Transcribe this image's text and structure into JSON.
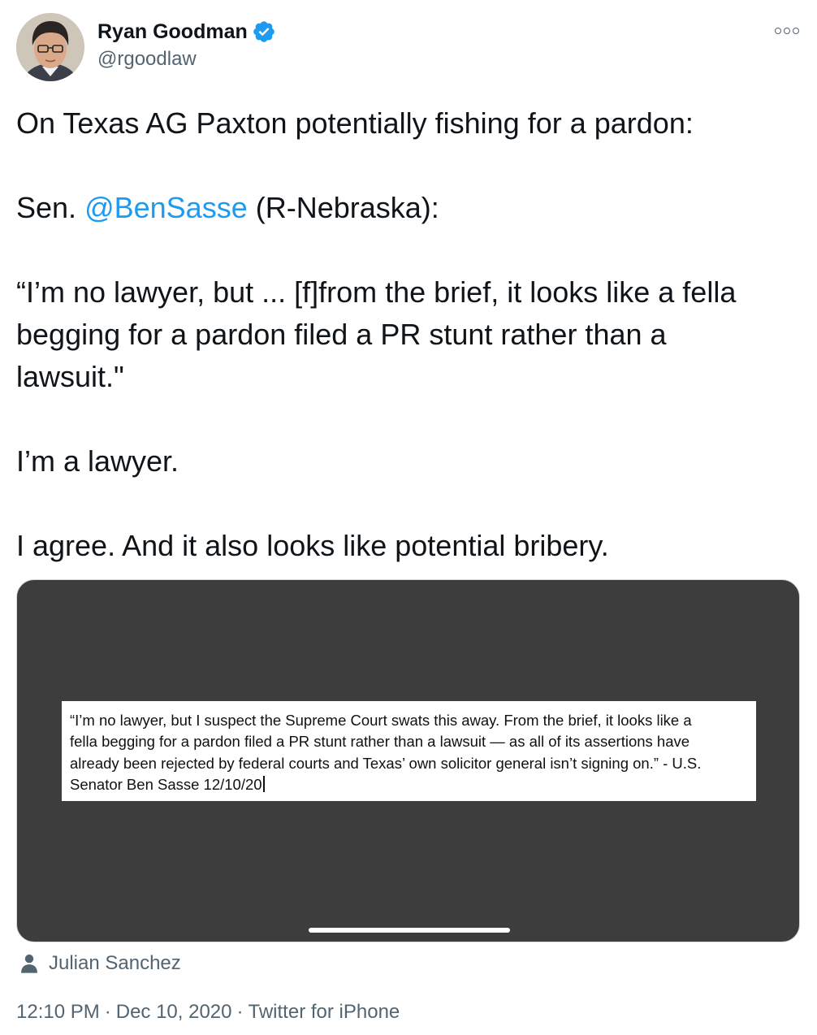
{
  "author": {
    "display_name": "Ryan Goodman",
    "handle": "@rgoodlaw",
    "verified": true,
    "avatar_icon": "user-avatar-photo"
  },
  "tweet": {
    "line1": "On Texas AG Paxton potentially fishing for a pardon:",
    "line2_prefix": "Sen. ",
    "line2_mention": "@BenSasse",
    "line2_suffix": " (R-Nebraska):",
    "quote_line1": "“I’m no lawyer, but ... [f]from the brief, it looks like a fella",
    "quote_line2": "begging for a pardon filed a PR stunt rather than a",
    "quote_line3": "lawsuit.\"",
    "line_lawyer": "I’m a lawyer.",
    "line_agree": "I agree. And it also looks like potential bribery."
  },
  "media": {
    "quote_text_1": "“I’m no lawyer, but I suspect the Supreme Court swats this away. From the brief, it looks like a",
    "quote_text_2": "fella begging for a pardon filed a PR stunt rather than a lawsuit — as all of its assertions have",
    "quote_text_3": "already been rejected by federal courts and Texas’ own solicitor general isn’t signing on.” - U.S.",
    "quote_text_4": "Senator Ben Sasse 12/10/20"
  },
  "tagged": {
    "icon": "person-icon",
    "name": "Julian Sanchez"
  },
  "meta": {
    "time": "12:10 PM",
    "date": "Dec 10, 2020",
    "source": "Twitter for iPhone",
    "separator": "·"
  },
  "colors": {
    "link": "#1d9bf0",
    "secondary_text": "#536471",
    "media_background": "#3d3d3d",
    "verified_badge": "#1d9bf0"
  }
}
